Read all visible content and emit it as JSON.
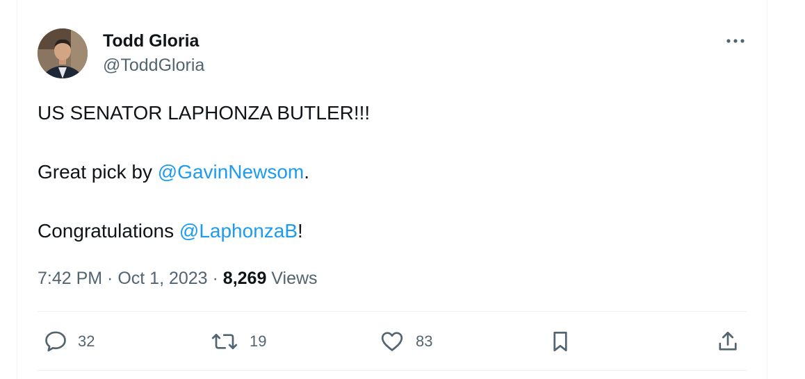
{
  "author": {
    "display_name": "Todd Gloria",
    "handle": "@ToddGloria"
  },
  "tweet": {
    "line1": "US SENATOR LAPHONZA BUTLER!!!",
    "line2_prefix": "Great pick by ",
    "line2_mention": "@GavinNewsom",
    "line2_suffix": ".",
    "line3_prefix": "Congratulations ",
    "line3_mention": "@LaphonzaB",
    "line3_suffix": "!"
  },
  "meta": {
    "time": "7:42 PM",
    "separator1": " · ",
    "date": "Oct 1, 2023",
    "separator2": " · ",
    "views_count": "8,269",
    "views_label": " Views"
  },
  "actions": {
    "replies": "32",
    "reposts": "19",
    "likes": "83"
  },
  "icons": {
    "more": "more-horizontal-icon",
    "reply": "speech-bubble-icon",
    "repost": "repost-arrows-icon",
    "like": "heart-icon",
    "bookmark": "bookmark-icon",
    "share": "share-upload-icon"
  },
  "colors": {
    "mention": "#1d9bf0",
    "secondary_text": "#536471",
    "primary_text": "#0f1419",
    "divider": "#eff3f4"
  }
}
